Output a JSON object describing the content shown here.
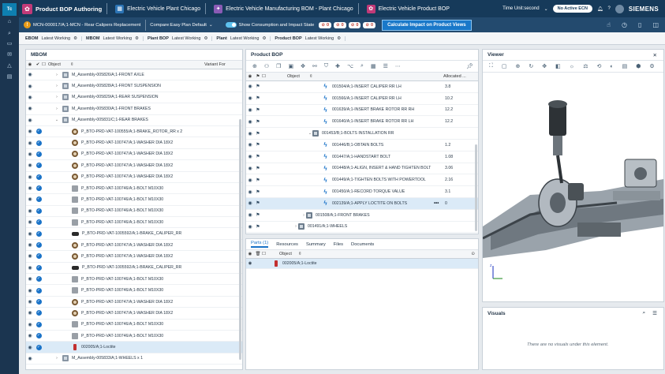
{
  "app": {
    "logo": "Tc",
    "title": "Product BOP Authoring"
  },
  "breadcrumbs": [
    "Electric Vehicle Plant Chicago",
    "Electric Vehicle Manufacturing BOM - Plant Chicago",
    "Electric Vehicle Product BOP"
  ],
  "top_right": {
    "time_unit": "Time Unit:second",
    "ecn": "No Active ECN",
    "brand": "SIEMENS"
  },
  "context": {
    "mcn": "MCN-000017/A;1-MCN - Rear Calipers Replacement",
    "revision_rule": "Compare:Easy Plan Default",
    "toggle_label": "Show Consumption and Impact State",
    "chips": [
      "0",
      "0",
      "0",
      "0"
    ],
    "calc_button": "Calculate Impact on Product Views"
  },
  "contexts": [
    {
      "name": "EBOM",
      "rule": "Latest Working"
    },
    {
      "name": "MBOM",
      "rule": "Latest Working"
    },
    {
      "name": "Plant BOP",
      "rule": "Latest Working"
    },
    {
      "name": "Plant",
      "rule": "Latest Working"
    },
    {
      "name": "Product BOP",
      "rule": "Latest Working"
    }
  ],
  "mbom": {
    "title": "MBOM",
    "col_object": "Object",
    "col_variant": "Variant For",
    "rows": [
      {
        "label": "M_Assembly-005826/A;1-FRONT AXLE",
        "icon": "asm",
        "tog": "›",
        "ind": 1,
        "chk": false
      },
      {
        "label": "M_Assembly-005828/A;1-FRONT SUSPENSION",
        "icon": "asm",
        "tog": "›",
        "ind": 1,
        "chk": false
      },
      {
        "label": "M_Assembly-005829/A;1-REAR SUSPENSION",
        "icon": "asm",
        "tog": "›",
        "ind": 1,
        "chk": false
      },
      {
        "label": "M_Assembly-005830/A;1-FRONT BRAKES",
        "icon": "asm",
        "tog": "›",
        "ind": 1,
        "chk": false
      },
      {
        "label": "M_Assembly-005831/C;1-REAR BRAKES",
        "icon": "asm",
        "tog": "⌄",
        "ind": 1,
        "chk": false
      },
      {
        "label": "P_BTO-PRD-VAT-100555/A;1-BRAKE_ROTOR_RR x 2",
        "icon": "washer",
        "tog": "",
        "ind": 2,
        "chk": true
      },
      {
        "label": "P_BTO-PRD-VAT-100747/A;1-WASHER DIA 18X2",
        "icon": "washer",
        "tog": "",
        "ind": 2,
        "chk": true
      },
      {
        "label": "P_BTO-PRD-VAT-100747/A;1-WASHER DIA 18X2",
        "icon": "washer",
        "tog": "",
        "ind": 2,
        "chk": true
      },
      {
        "label": "P_BTO-PRD-VAT-100747/A;1-WASHER DIA 18X2",
        "icon": "washer",
        "tog": "",
        "ind": 2,
        "chk": true
      },
      {
        "label": "P_BTO-PRD-VAT-100747/A;1-WASHER DIA 18X2",
        "icon": "washer",
        "tog": "",
        "ind": 2,
        "chk": true
      },
      {
        "label": "P_BTO-PRD-VAT-100746/A;1-BOLT M10X30",
        "icon": "bolt",
        "tog": "",
        "ind": 2,
        "chk": true
      },
      {
        "label": "P_BTO-PRD-VAT-100746/A;1-BOLT M10X30",
        "icon": "bolt",
        "tog": "",
        "ind": 2,
        "chk": true
      },
      {
        "label": "P_BTO-PRD-VAT-100746/A;1-BOLT M10X30",
        "icon": "bolt",
        "tog": "",
        "ind": 2,
        "chk": true
      },
      {
        "label": "P_BTO-PRD-VAT-100746/A;1-BOLT M10X30",
        "icon": "bolt",
        "tog": "",
        "ind": 2,
        "chk": true
      },
      {
        "label": "P_BTO-PRD-VAT-1005592/A;1-BRAKE_CALIPER_RR",
        "icon": "brk",
        "tog": "",
        "ind": 2,
        "chk": true
      },
      {
        "label": "P_BTO-PRD-VAT-100747/A;1-WASHER DIA 18X2",
        "icon": "washer",
        "tog": "",
        "ind": 2,
        "chk": true
      },
      {
        "label": "P_BTO-PRD-VAT-100747/A;1-WASHER DIA 18X2",
        "icon": "washer",
        "tog": "",
        "ind": 2,
        "chk": true
      },
      {
        "label": "P_BTO-PRD-VAT-1005592/A;1-BRAKE_CALIPER_RR",
        "icon": "brk",
        "tog": "",
        "ind": 2,
        "chk": true
      },
      {
        "label": "P_BTO-PRD-VAT-100746/A;1-BOLT M10X30",
        "icon": "bolt",
        "tog": "",
        "ind": 2,
        "chk": true
      },
      {
        "label": "P_BTO-PRD-VAT-100746/A;1-BOLT M10X30",
        "icon": "bolt",
        "tog": "",
        "ind": 2,
        "chk": true
      },
      {
        "label": "P_BTO-PRD-VAT-100747/A;1-WASHER DIA 18X2",
        "icon": "washer",
        "tog": "",
        "ind": 2,
        "chk": true
      },
      {
        "label": "P_BTO-PRD-VAT-100747/A;1-WASHER DIA 18X2",
        "icon": "washer",
        "tog": "",
        "ind": 2,
        "chk": true
      },
      {
        "label": "P_BTO-PRD-VAT-100746/A;1-BOLT M10X30",
        "icon": "bolt",
        "tog": "",
        "ind": 2,
        "chk": true
      },
      {
        "label": "P_BTO-PRD-VAT-100746/A;1-BOLT M10X30",
        "icon": "bolt",
        "tog": "",
        "ind": 2,
        "chk": true
      },
      {
        "label": "002005/A;1-Loctite",
        "icon": "bottle",
        "tog": "",
        "ind": 2,
        "chk": true,
        "sel": true
      },
      {
        "label": "M_Assembly-005833/A;1-WHEELS x 1",
        "icon": "asm",
        "tog": "›",
        "ind": 1,
        "chk": false
      }
    ]
  },
  "bop": {
    "title": "Product BOP",
    "col_object": "Object",
    "col_alloc": "Allocated ...",
    "rows": [
      {
        "label": "001504/A;1-INSERT CALIPER RR LH",
        "value": "3.8",
        "icon": "op",
        "ind": 3
      },
      {
        "label": "001566/A;1-INSERT CALIPER RR LH",
        "value": "10.2",
        "icon": "op",
        "ind": 3
      },
      {
        "label": "001639/A;1-INSERT BRAKE ROTOR RR RH",
        "value": "12.2",
        "icon": "op",
        "ind": 3
      },
      {
        "label": "001640/A;1-INSERT BRAKE ROTOR RR LH",
        "value": "12.2",
        "icon": "op",
        "ind": 3
      },
      {
        "label": "001453/B;1-BOLTS INSTALLATION RR",
        "value": "",
        "icon": "proc",
        "ind": 2,
        "tog": "⌄"
      },
      {
        "label": "001446/B;1-OBTAIN BOLTS",
        "value": "1.2",
        "icon": "op",
        "ind": 3
      },
      {
        "label": "001447/A;1-HANDSTART BOLT",
        "value": "1.08",
        "icon": "op",
        "ind": 3
      },
      {
        "label": "001448/A;1-ALIGN, INSERT & HAND TIGHTEN BOLT",
        "value": "3.06",
        "icon": "op",
        "ind": 3
      },
      {
        "label": "001449/A;1-TIGHTEN BOLTS WITH POWERTOOL",
        "value": "2.16",
        "icon": "op",
        "ind": 3
      },
      {
        "label": "001450/A;1-RECORD TORQUE VALUE",
        "value": "3.1",
        "icon": "op",
        "ind": 3
      },
      {
        "label": "002139/A;1-APPLY LOCTITE ON BOLTS",
        "value": "0",
        "icon": "op",
        "ind": 3,
        "sel": true
      },
      {
        "label": "001508/A;1-FRONT BRAKES",
        "value": "",
        "icon": "proc",
        "ind": 1,
        "tog": "›"
      },
      {
        "label": "001491/A;1-WHEELS",
        "value": "",
        "icon": "proc",
        "ind": 0,
        "tog": "›"
      }
    ]
  },
  "parts": {
    "tabs": [
      "Parts (1)",
      "Resources",
      "Summary",
      "Files",
      "Documents"
    ],
    "col_object": "Object",
    "rows": [
      {
        "label": "002005/A;1-Loctite"
      }
    ]
  },
  "viewer": {
    "title": "Viewer"
  },
  "visuals": {
    "title": "Visuals",
    "empty": "There are no visuals under this element."
  },
  "colors": {
    "header": "#163a5a",
    "accent": "#1a73c8",
    "rail": "#1b3550"
  }
}
